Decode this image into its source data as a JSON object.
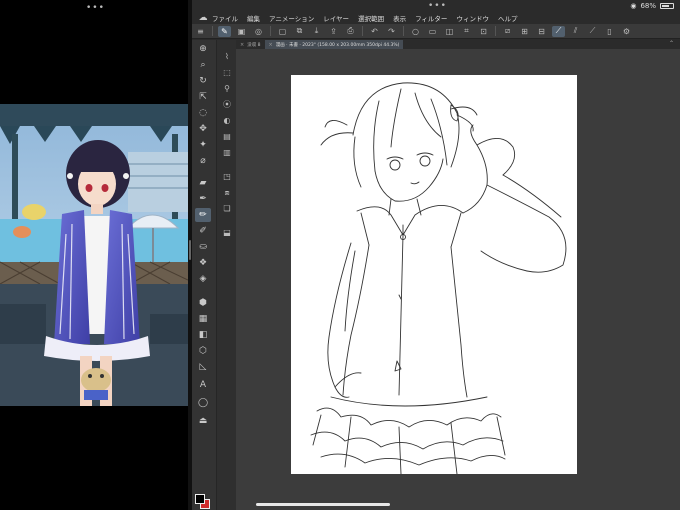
{
  "left_pane": {
    "handle": "•••"
  },
  "status": {
    "battery_percent": "68%",
    "battery_level": 0.68
  },
  "app": {
    "handle": "•••",
    "logo": "☁",
    "menus": [
      "ファイル",
      "編集",
      "アニメーション",
      "レイヤー",
      "選択範囲",
      "表示",
      "フィルター",
      "ウィンドウ",
      "ヘルプ"
    ]
  },
  "tabs": [
    {
      "label": "没収 8",
      "active": false
    },
    {
      "label": "漫画 · 未書 · 2023° (158.00 x 203.00mm 350dpi 44.3%)",
      "active": true
    }
  ],
  "colors": {
    "foreground": "#000000",
    "background": "#d02a2a",
    "accent": "#52606e"
  }
}
